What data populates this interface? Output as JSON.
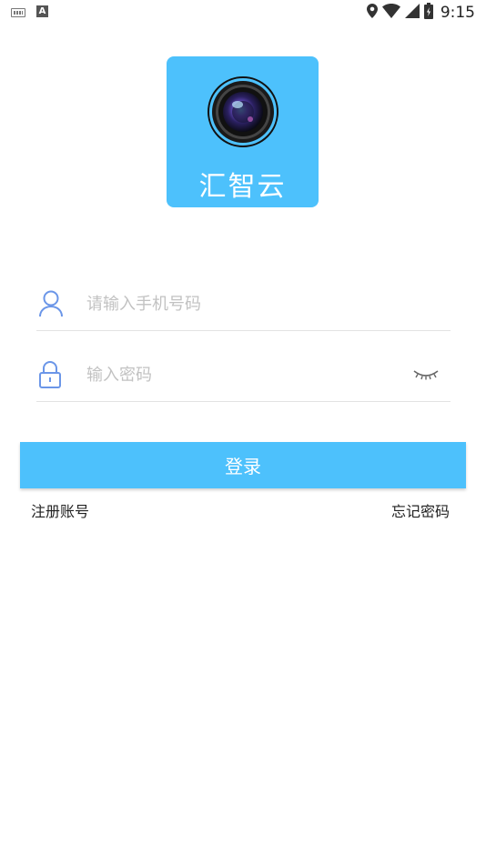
{
  "status_bar": {
    "time": "9:15",
    "left_icons": [
      "keyboard-icon",
      "font-a-icon"
    ],
    "right_icons": [
      "location-icon",
      "wifi-icon",
      "signal-icon",
      "battery-icon"
    ],
    "a_glyph": "A"
  },
  "logo": {
    "app_name": "汇智云",
    "background_color": "#4dc1fc"
  },
  "form": {
    "phone": {
      "placeholder": "请输入手机号码",
      "value": "",
      "icon": "user-icon"
    },
    "password": {
      "placeholder": "输入密码",
      "value": "",
      "icon": "lock-icon",
      "toggle_icon": "eye-closed-icon"
    }
  },
  "login_button": {
    "label": "登录",
    "color": "#4dc1fc"
  },
  "links": {
    "register": "注册账号",
    "forgot_password": "忘记密码"
  }
}
